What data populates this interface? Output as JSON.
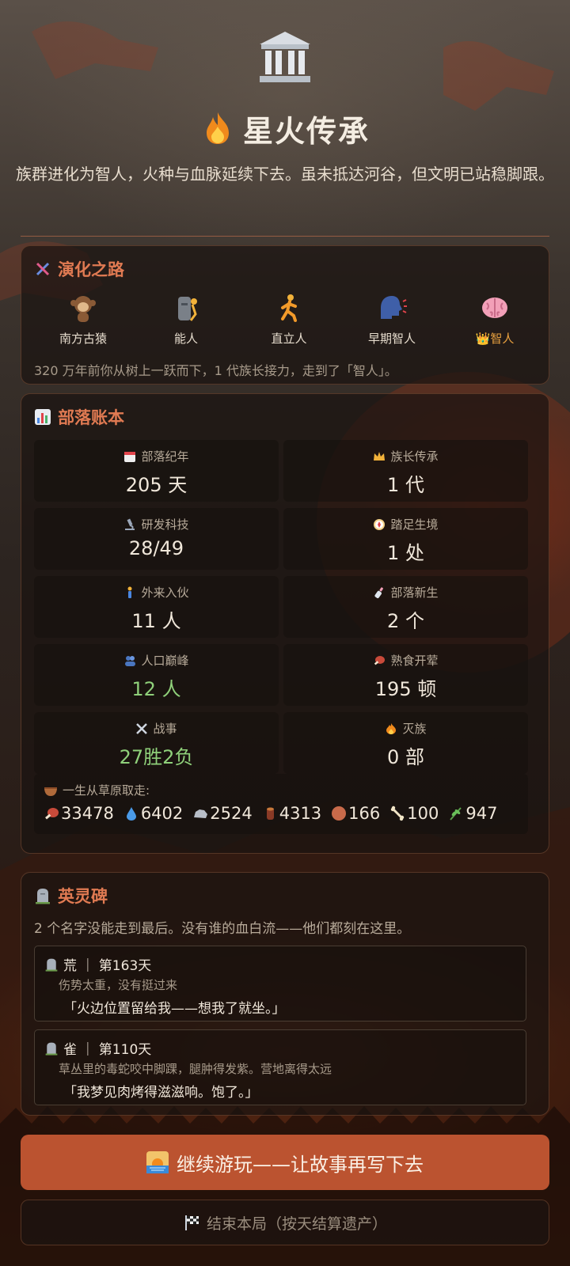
{
  "header": {
    "title_icon": "temple-icon",
    "title_emoji": "fire-icon",
    "title": "星火传承",
    "subtitle": "族群进化为智人，火种与血脉延续下去。虽未抵达河谷，但文明已站稳脚跟。"
  },
  "evolution": {
    "title": "演化之路",
    "icon": "dna-icon",
    "steps": [
      {
        "icon": "monkey-icon",
        "label": "南方古猿"
      },
      {
        "icon": "moai-icon",
        "label": "能人"
      },
      {
        "icon": "running-person-icon",
        "label": "直立人"
      },
      {
        "icon": "speaking-head-icon",
        "label": "早期智人"
      },
      {
        "icon": "brain-icon",
        "label": "👑智人",
        "current": true
      }
    ],
    "description": "320 万年前你从树上一跃而下，1 代族长接力，走到了「智人」。"
  },
  "ledger": {
    "title": "部落账本",
    "icon": "bar-chart-icon",
    "stats": [
      {
        "icon": "calendar-icon",
        "label": "部落纪年",
        "value": "205 天"
      },
      {
        "icon": "crown-icon",
        "label": "族长传承",
        "value": "1 代"
      },
      {
        "icon": "microscope-icon",
        "label": "研发科技",
        "value": "28/49"
      },
      {
        "icon": "compass-icon",
        "label": "踏足生境",
        "value": "1 处"
      },
      {
        "icon": "person-icon",
        "label": "外来入伙",
        "value": "11 人"
      },
      {
        "icon": "baby-bottle-icon",
        "label": "部落新生",
        "value": "2 个"
      },
      {
        "icon": "people-icon",
        "label": "人口巅峰",
        "value": "12 人",
        "highlight": "#8fd07a"
      },
      {
        "icon": "meat-icon",
        "label": "熟食开荤",
        "value": "195 顿"
      },
      {
        "icon": "crossed-swords-icon",
        "label": "战事",
        "value": "27胜2负",
        "highlight": "#8fd07a"
      },
      {
        "icon": "fire-icon",
        "label": "灭族",
        "value": "0 部"
      }
    ],
    "spoils_title": "一生从草原取走:",
    "spoils_icon": "bowl-icon",
    "resources": [
      {
        "icon": "meat-icon",
        "value": "33478"
      },
      {
        "icon": "water-drop-icon",
        "value": "6402"
      },
      {
        "icon": "rock-icon",
        "value": "2524"
      },
      {
        "icon": "wood-icon",
        "value": "4313"
      },
      {
        "icon": "clay-icon",
        "value": "166"
      },
      {
        "icon": "bone-icon",
        "value": "100"
      },
      {
        "icon": "herb-icon",
        "value": "947"
      }
    ]
  },
  "memorial": {
    "title": "英灵碑",
    "icon": "headstone-icon",
    "description": "2 个名字没能走到最后。没有谁的血白流——他们都刻在这里。",
    "entries": [
      {
        "name_line": "荒 ｜ 第163天",
        "cause": "伤势太重，没有挺过来",
        "quote": "「火边位置留给我——想我了就坐。」"
      },
      {
        "name_line": "雀 ｜ 第110天",
        "cause": "草丛里的毒蛇咬中脚踝，腿肿得发紫。营地离得太远",
        "quote": "「我梦见肉烤得滋滋响。饱了。」"
      }
    ]
  },
  "actions": {
    "continue_icon": "sunrise-icon",
    "continue_label": "继续游玩——让故事再写下去",
    "end_icon": "checkered-flag-icon",
    "end_label": "结束本局（按天结算遗产）"
  },
  "colors": {
    "accent": "#e07a52",
    "button": "#bb5330",
    "positive": "#8fd07a",
    "crown": "#e9a13f"
  }
}
